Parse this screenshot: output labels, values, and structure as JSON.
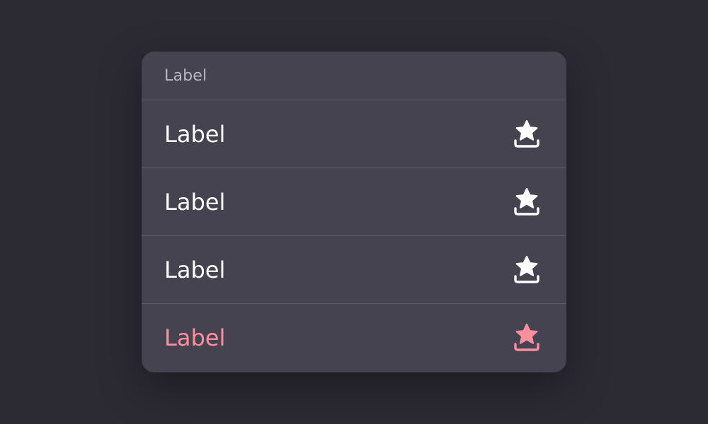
{
  "menu": {
    "header": "Label",
    "items": [
      {
        "label": "Label",
        "icon": "star-tray-icon",
        "color": "#ffffff"
      },
      {
        "label": "Label",
        "icon": "star-tray-icon",
        "color": "#ffffff"
      },
      {
        "label": "Label",
        "icon": "star-tray-icon",
        "color": "#ffffff"
      },
      {
        "label": "Label",
        "icon": "star-tray-icon",
        "color": "#ff8f9e",
        "destructive": true
      }
    ]
  },
  "colors": {
    "background": "#2c2a33",
    "surface": "#45434f",
    "divider": "#5c5a66",
    "header_text": "#b9b7c2",
    "accent_pink": "#ff8f9e"
  }
}
